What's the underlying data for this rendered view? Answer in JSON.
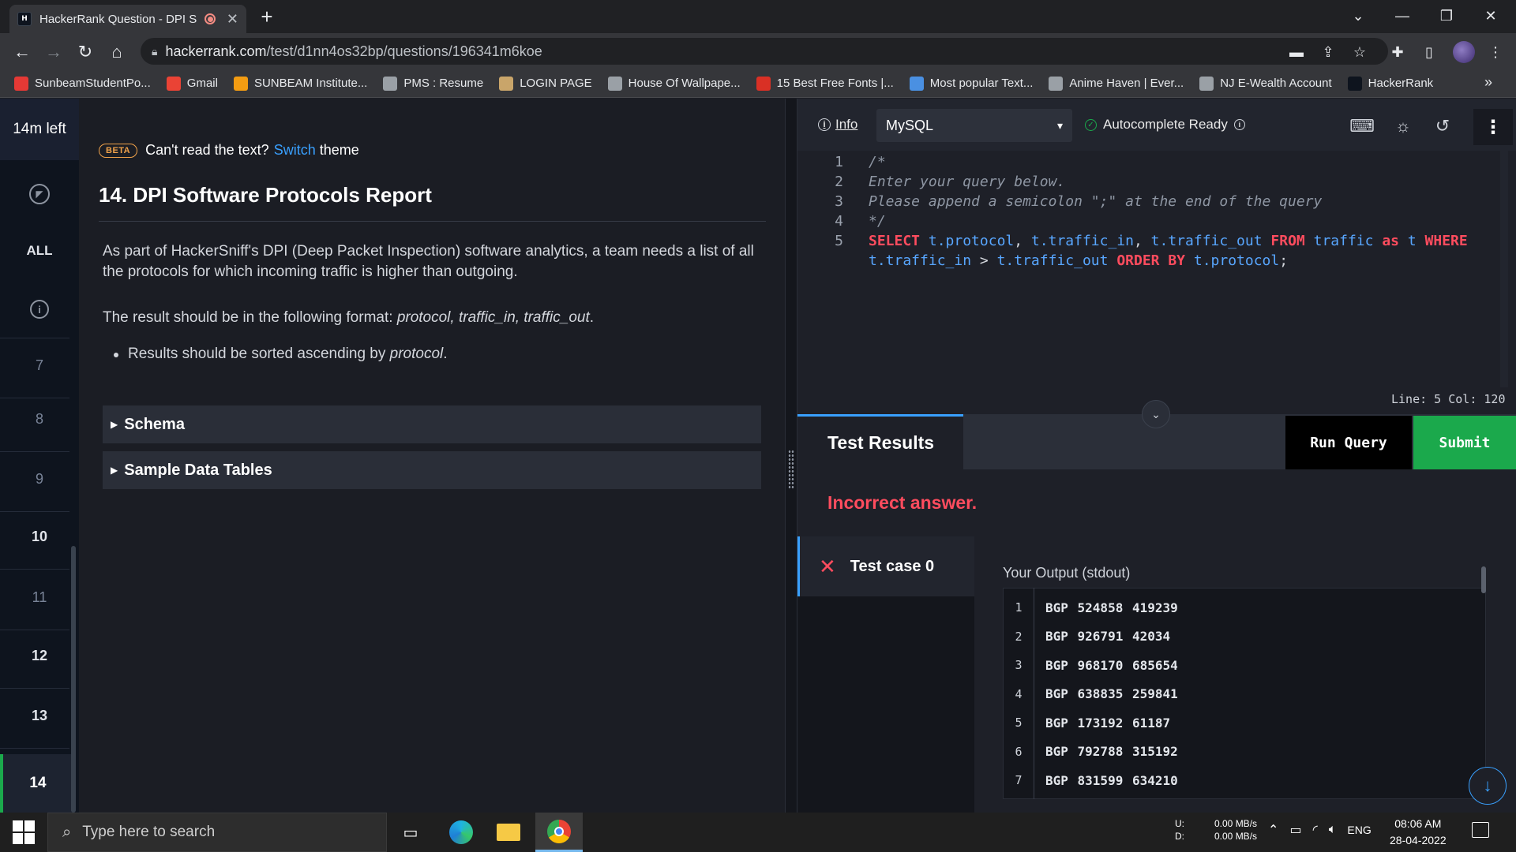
{
  "browser": {
    "tab_title": "HackerRank Question - DPI S",
    "url_host": "hackerrank.com",
    "url_path": "/test/d1nn4os32bp/questions/196341m6koe",
    "bookmarks": [
      {
        "label": "SunbeamStudentPo...",
        "color": "#e53935"
      },
      {
        "label": "Gmail",
        "color": "#ea4335"
      },
      {
        "label": "SUNBEAM Institute...",
        "color": "#f39c12"
      },
      {
        "label": "PMS : Resume",
        "color": "#9aa0a6"
      },
      {
        "label": "LOGIN PAGE",
        "color": "#c9a56a"
      },
      {
        "label": "House Of Wallpape...",
        "color": "#9aa0a6"
      },
      {
        "label": "15 Best Free Fonts |...",
        "color": "#d93025"
      },
      {
        "label": "Most popular Text...",
        "color": "#4a90e2"
      },
      {
        "label": "Anime Haven | Ever...",
        "color": "#9aa0a6"
      },
      {
        "label": "NJ E-Wealth Account",
        "color": "#9aa0a6"
      },
      {
        "label": "HackerRank",
        "color": "#0e141e"
      }
    ]
  },
  "rail": {
    "time_left": "14m left",
    "all_label": "ALL",
    "questions": [
      "7",
      "8",
      "9",
      "10",
      "11",
      "12",
      "13",
      "14"
    ],
    "done": [
      false,
      false,
      false,
      true,
      false,
      true,
      true,
      true
    ]
  },
  "problem": {
    "beta_badge": "BETA",
    "cant_read": "Can't read the text?",
    "switch_link": "Switch",
    "theme_word": "theme",
    "title": "14. DPI Software Protocols Report",
    "para1": "As part of HackerSniff's DPI (Deep Packet Inspection) software analytics, a team needs a list of all the protocols for which incoming traffic is higher than outgoing.",
    "para2_prefix": "The result should be in the following format: ",
    "para2_format": "protocol, traffic_in, traffic_out",
    "para2_suffix": ".",
    "bullet_prefix": "Results should be sorted ascending by ",
    "bullet_em": "protocol",
    "bullet_suffix": ".",
    "accordions": [
      "Schema",
      "Sample Data Tables"
    ]
  },
  "editor": {
    "info_label": "Info",
    "language": "MySQL",
    "autocomplete": "Autocomplete Ready",
    "status": "Line: 5 Col: 120",
    "line_numbers": [
      "1",
      "2",
      "3",
      "4",
      "5"
    ],
    "comment_lines": [
      "/*",
      "Enter your query below.",
      "Please append a semicolon \";\" at the end of the query",
      "*/"
    ]
  },
  "results": {
    "tab_label": "Test Results",
    "run_query": "Run Query",
    "submit": "Submit",
    "verdict": "Incorrect answer.",
    "test_case": "Test case 0",
    "output_label": "Your Output (stdout)",
    "rows": [
      {
        "n": "1",
        "text": "BGP 524858 419239"
      },
      {
        "n": "2",
        "text": "BGP 926791 42034"
      },
      {
        "n": "3",
        "text": "BGP 968170 685654"
      },
      {
        "n": "4",
        "text": "BGP 638835 259841"
      },
      {
        "n": "5",
        "text": "BGP 173192 61187"
      },
      {
        "n": "6",
        "text": "BGP 792788 315192"
      },
      {
        "n": "7",
        "text": "BGP 831599 634210"
      }
    ]
  },
  "taskbar": {
    "search_placeholder": "Type here to search",
    "net_up_label": "U:",
    "net_down_label": "D:",
    "net_up": "0.00 MB/s",
    "net_down": "0.00 MB/s",
    "lang": "ENG",
    "time": "08:06 AM",
    "date": "28-04-2022"
  }
}
